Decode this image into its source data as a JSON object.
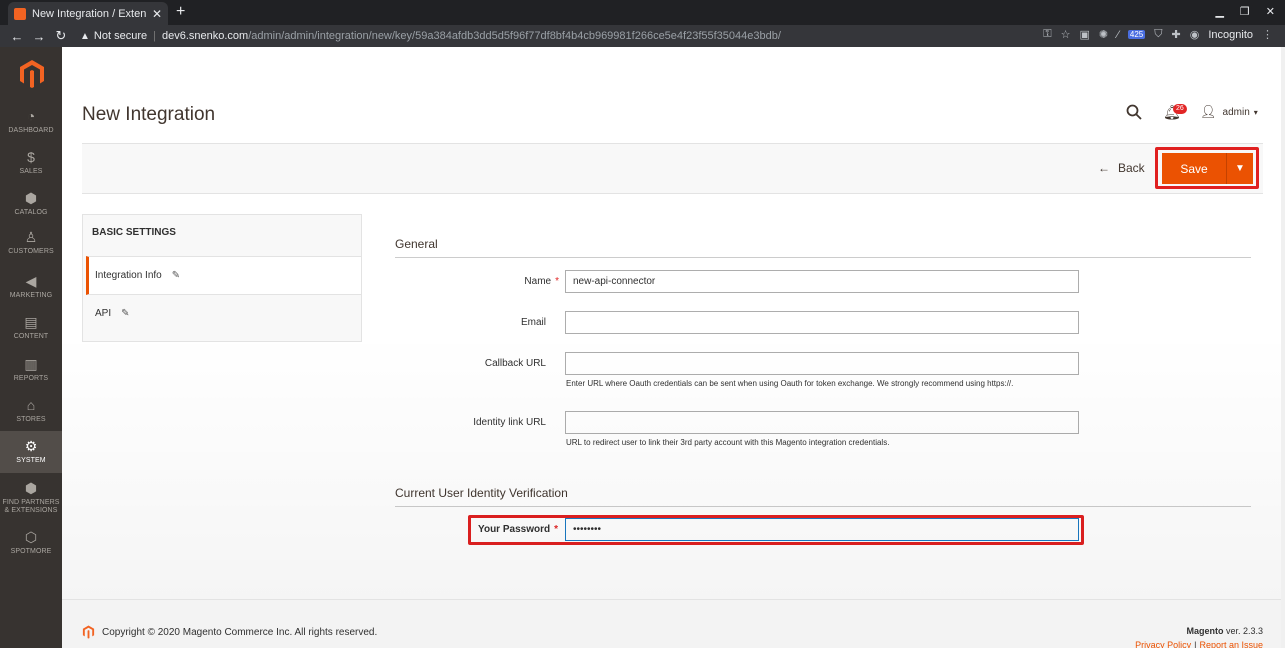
{
  "browser": {
    "tab_title": "New Integration / Extensi",
    "tab_close": "✕",
    "new_tab": "+",
    "security": "Not secure",
    "url_host": "dev6.snenko.com",
    "url_path": "/admin/admin/integration/new/key/59a384afdb3dd5d5f96f77df8bf4b4cb969981f266ce5e4f23f55f35044e3bdb/",
    "ext_badge": "425",
    "incognito_label": "Incognito"
  },
  "sidebar": {
    "items": [
      {
        "icon": "dashboard-icon",
        "label": "DASHBOARD"
      },
      {
        "icon": "dollar-icon",
        "label": "SALES"
      },
      {
        "icon": "cube-icon",
        "label": "CATALOG"
      },
      {
        "icon": "person-icon",
        "label": "CUSTOMERS"
      },
      {
        "icon": "megaphone-icon",
        "label": "MARKETING"
      },
      {
        "icon": "content-icon",
        "label": "CONTENT"
      },
      {
        "icon": "bar-chart-icon",
        "label": "REPORTS"
      },
      {
        "icon": "store-icon",
        "label": "STORES"
      },
      {
        "icon": "gear-icon",
        "label": "SYSTEM"
      },
      {
        "icon": "box-icon",
        "label": "FIND PARTNERS & EXTENSIONS"
      },
      {
        "icon": "hexagon-icon",
        "label": "SPOTMORE"
      }
    ],
    "active": "SYSTEM"
  },
  "header": {
    "title": "New Integration",
    "notification_count": "26",
    "user": "admin"
  },
  "actions": {
    "back_label": "Back",
    "save_label": "Save"
  },
  "tabs": {
    "title": "BASIC SETTINGS",
    "items": [
      {
        "label": "Integration Info",
        "active": true
      },
      {
        "label": "API",
        "active": false
      }
    ]
  },
  "form": {
    "general_title": "General",
    "name_label": "Name",
    "name_value": "new-api-connector",
    "email_label": "Email",
    "email_value": "",
    "callback_label": "Callback URL",
    "callback_value": "",
    "callback_note": "Enter URL where Oauth credentials can be sent when using Oauth for token exchange. We strongly recommend using https://.",
    "identity_label": "Identity link URL",
    "identity_value": "",
    "identity_note": "URL to redirect user to link their 3rd party account with this Magento integration credentials.",
    "verify_title": "Current User Identity Verification",
    "password_label": "Your Password",
    "password_value": "••••••••"
  },
  "footer": {
    "copyright": "Copyright © 2020 Magento Commerce Inc. All rights reserved.",
    "brand": "Magento",
    "version": "ver. 2.3.3",
    "privacy": "Privacy Policy",
    "report": "Report an Issue"
  },
  "colors": {
    "accent": "#eb5202",
    "sidebar_bg": "#373330",
    "highlight": "#e02020"
  }
}
